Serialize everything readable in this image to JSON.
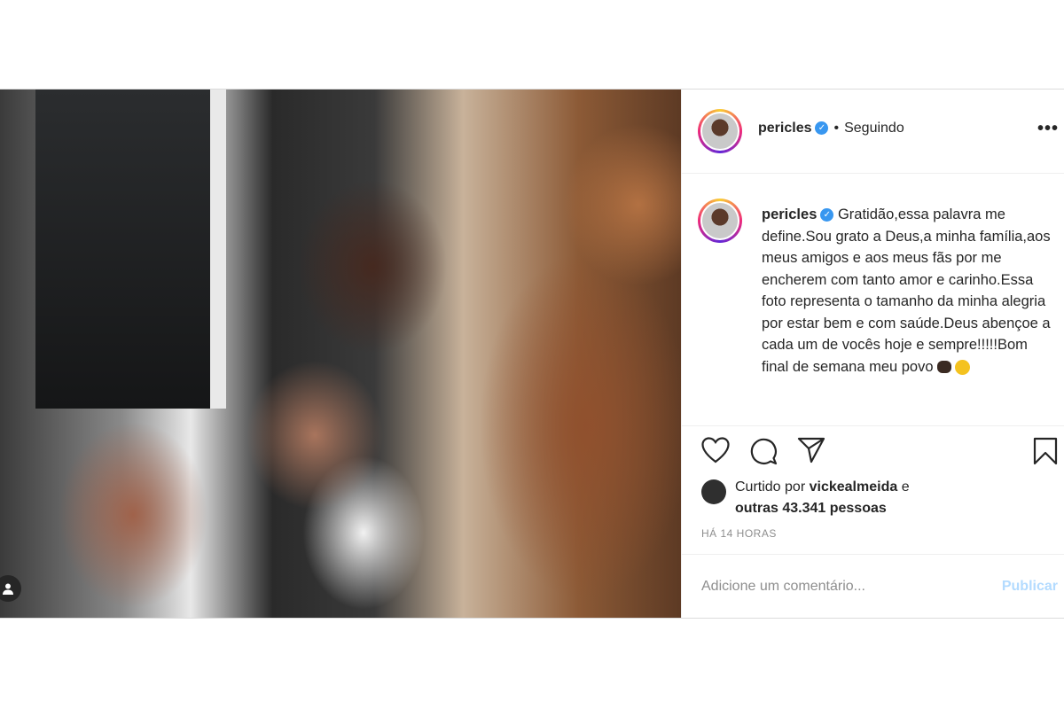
{
  "header": {
    "username": "pericles",
    "separator": "•",
    "following": "Seguindo",
    "more": "•••"
  },
  "caption": {
    "username": "pericles",
    "text": "Gratidão,essa palavra me define.Sou grato a Deus,a minha família,aos meus amigos e aos meus fãs por me encherem com tanto amor e carinho.Essa foto representa o tamanho da minha alegria por estar bem e com saúde.Deus abençoe a cada um de vocês hoje e sempre!!!!!Bom final de semana meu povo"
  },
  "likes": {
    "prefix": "Curtido por",
    "user": "vickealmeida",
    "conj": "e",
    "others": "outras 43.341 pessoas"
  },
  "time": "HÁ 14 HORAS",
  "comment": {
    "placeholder": "Adicione um comentário...",
    "publish": "Publicar"
  },
  "icons": [
    "heart-icon",
    "comment-icon",
    "share-icon",
    "bookmark-icon",
    "verified-icon",
    "user-tag-icon"
  ]
}
